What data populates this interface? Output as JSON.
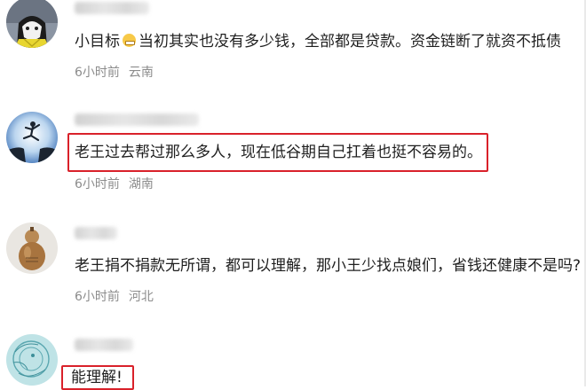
{
  "comments": [
    {
      "text_before": "小目标",
      "text_after": "当初其实也没有多少钱，全部都是贷款。资金链断了就资不抵债",
      "time": "6小时前",
      "location": "云南",
      "emoji": "grin-emoji"
    },
    {
      "text": "老王过去帮过那么多人，现在低谷期自己扛着也挺不容易的。",
      "time": "6小时前",
      "location": "湖南",
      "highlight_color": "#d9212a"
    },
    {
      "text": "老王捐不捐款无所谓，都可以理解，那小王少找点娘们，省钱还健康不是吗?",
      "time": "6小时前",
      "location": "河北"
    },
    {
      "text": "能理解!",
      "highlight_color": "#d9212a"
    }
  ],
  "colors": {
    "meta_text": "#8c8c8c",
    "highlight_border": "#d9212a"
  },
  "icons": [
    "cat-avatar-icon",
    "leap-avatar-icon",
    "gourd-avatar-icon",
    "sketch-avatar-icon"
  ]
}
